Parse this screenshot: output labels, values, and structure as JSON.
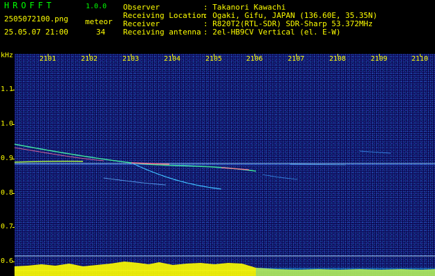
{
  "app": {
    "title": "HROFFT",
    "version": "1.0.0"
  },
  "file": {
    "name": "2505072100.png",
    "datetime": "25.05.07 21:00"
  },
  "meteor": {
    "label": "meteor",
    "count": "34"
  },
  "info": [
    {
      "key": "Observer",
      "value": ": Takanori Kawachi"
    },
    {
      "key": "Receiving Location",
      "value": ": Ogaki, Gifu, JAPAN (136.60E, 35.35N)"
    },
    {
      "key": "Receiver",
      "value": ": R820T2(RTL-SDR) SDR-Sharp 53.372MHz"
    },
    {
      "key": "Receiving antenna",
      "value": ": 2el-HB9CV Vertical (el. E-W)"
    }
  ],
  "axis": {
    "y_unit": "kHz",
    "y_ticks": [
      "1.1",
      "1.0",
      "0.9",
      "0.8",
      "0.7",
      "0.6"
    ],
    "x_ticks": [
      "2101",
      "2102",
      "2103",
      "2104",
      "2105",
      "2106",
      "2107",
      "2108",
      "2109",
      "2110"
    ]
  },
  "colors": {
    "label": "#ffff00",
    "title": "#00ff00",
    "background": "#0a0a52",
    "carrier": "#8fd8ff",
    "echo": "#40e0a0"
  }
}
